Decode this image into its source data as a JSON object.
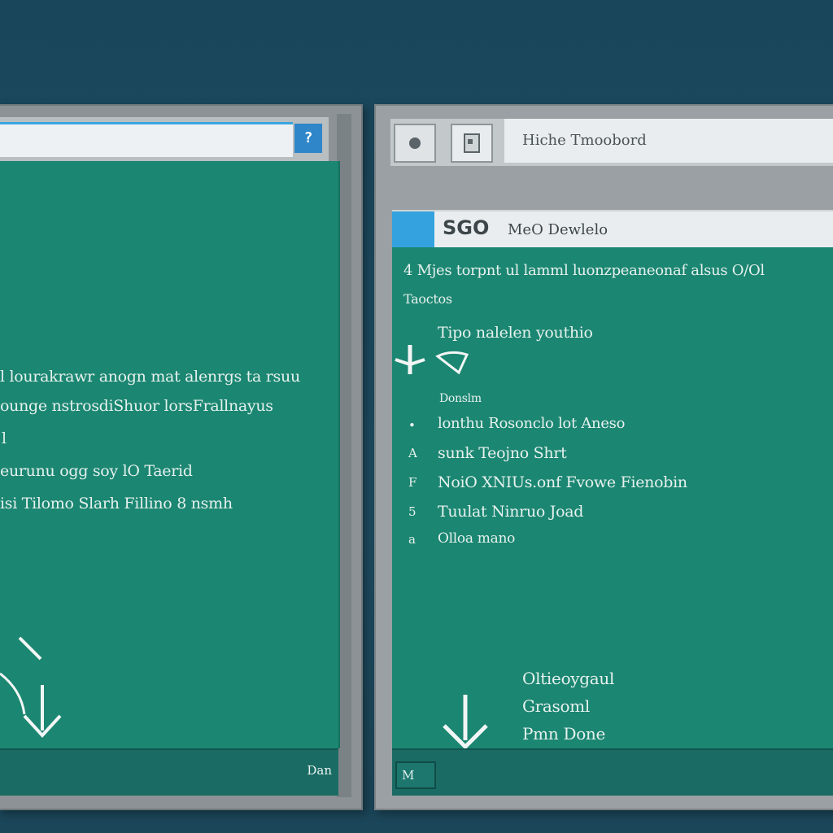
{
  "left_window": {
    "info_button_glyph": "?",
    "lines": [
      "l lourakrawr anogn mat alenrgs ta rsuu",
      "ounge nstrosdiShuor lorsFrallnayus",
      "l",
      "eurunu ogg soy lO Taerid",
      "isi Tilomo Slarh Fillino 8 nsmh"
    ],
    "footer_label": "Dan"
  },
  "right_window": {
    "titlebar_title": "Hiche Tmoobord",
    "header_logo": "SGO",
    "header_title": "MeO Dewlelo",
    "intro_line": "4 Mjes torpnt  ul lamml luonzpeaneonaf  alsus O/Ol",
    "intro_line2": "Taoctos",
    "subheading": "Tipo  nalelen youthio",
    "small_label": "Donslm",
    "list_items": [
      {
        "bullet": "•",
        "text": "lonthu Rosonclo lot  Aneso"
      },
      {
        "bullet": "A",
        "text": "sunk  Teojno Shrt"
      },
      {
        "bullet": "F",
        "text": "NoiO  XNIUs.onf  Fvowe  Fienobin"
      },
      {
        "bullet": "5",
        "text": "Tuulat  Ninruo  Joad"
      },
      {
        "bullet": "a",
        "text": "Olloa  mano"
      }
    ],
    "options": [
      "Oltieoygaul",
      "Grasoml",
      "Pmn Done"
    ],
    "footer_button": "M"
  },
  "colors": {
    "desktop": "#1d4a5f",
    "pane_teal": "#1b8671",
    "footer_teal": "#1a6b63",
    "accent_blue": "#34a2df"
  }
}
